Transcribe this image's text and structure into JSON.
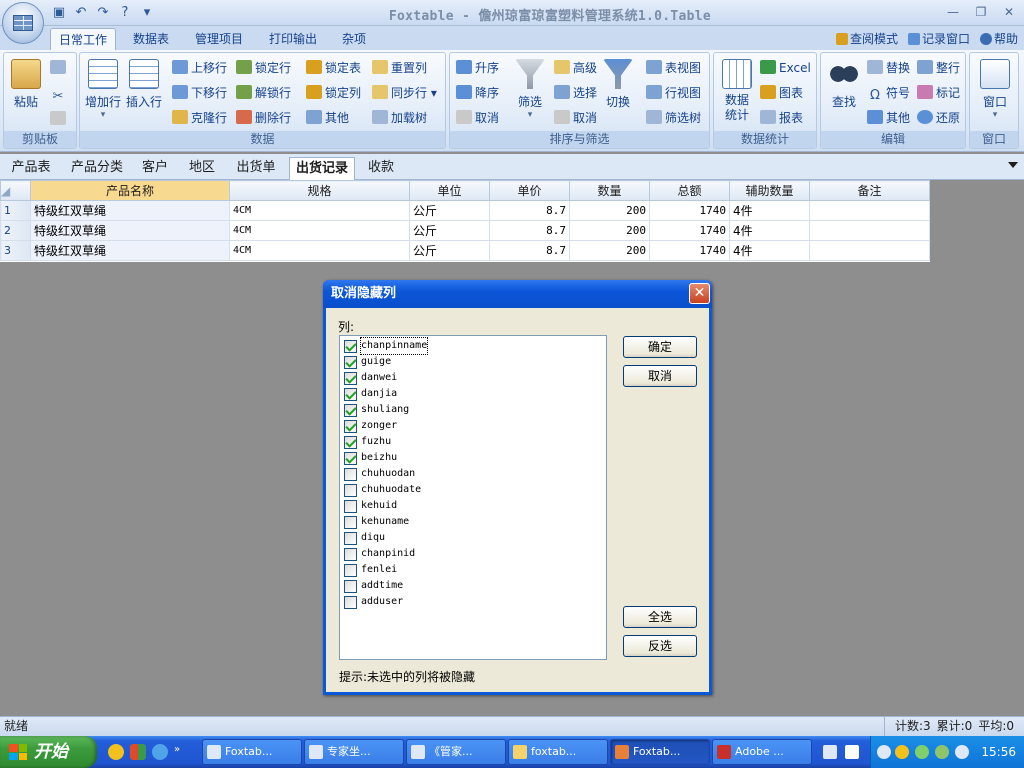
{
  "app": {
    "title": "Foxtable - 儋州琼富琼富塑料管理系统1.0.Table",
    "win_min": "—",
    "win_max": "❐",
    "win_close": "✕"
  },
  "ribbon_tabs": [
    "日常工作",
    "数据表",
    "管理项目",
    "打印输出",
    "杂项"
  ],
  "top_right": {
    "view_mode": "查阅模式",
    "record_window": "记录窗口",
    "help": "帮助"
  },
  "ribbon": {
    "clipboard": {
      "label": "剪贴板",
      "paste": "粘贴"
    },
    "data": {
      "label": "数据",
      "add_row": "增加行",
      "insert_row": "插入行",
      "move_up": "上移行",
      "move_down": "下移行",
      "clone_row": "克隆行",
      "lock_row": "锁定行",
      "unlock_row": "解锁行",
      "delete_row": "删除行",
      "lock_table": "锁定表",
      "lock_col": "锁定列",
      "other": "其他",
      "reset_col": "重置列",
      "sync_row": "同步行",
      "load_tree": "加载树"
    },
    "sort_filter": {
      "label": "排序与筛选",
      "asc": "升序",
      "desc": "降序",
      "cancel": "取消",
      "filter": "筛选",
      "advanced": "高级",
      "select": "选择",
      "cancel2": "取消",
      "toggle": "切换",
      "table_view": "表视图",
      "row_view": "行视图",
      "filter_tree": "筛选树"
    },
    "stats": {
      "label": "数据统计",
      "data_stats": "数据统计",
      "excel": "Excel",
      "chart": "图表",
      "report": "报表"
    },
    "edit": {
      "label": "编辑",
      "find": "查找",
      "replace": "替换",
      "symbol": "符号",
      "other": "其他",
      "tidy_row": "整行",
      "mark": "标记",
      "restore": "还原"
    },
    "window": {
      "label": "窗口",
      "window": "窗口"
    }
  },
  "sheet_tabs": [
    "产品表",
    "产品分类",
    "客户",
    "地区",
    "出货单",
    "出货记录",
    "收款"
  ],
  "active_sheet": "出货记录",
  "grid": {
    "columns": [
      "产品名称",
      "规格",
      "单位",
      "单价",
      "数量",
      "总额",
      "辅助数量",
      "备注"
    ],
    "rows": [
      {
        "n": "1",
        "name": "特级红双草绳",
        "spec": "4CM",
        "unit": "公斤",
        "price": "8.7",
        "qty": "200",
        "total": "1740",
        "aux": "4件",
        "note": ""
      },
      {
        "n": "2",
        "name": "特级红双草绳",
        "spec": "4CM",
        "unit": "公斤",
        "price": "8.7",
        "qty": "200",
        "total": "1740",
        "aux": "4件",
        "note": ""
      },
      {
        "n": "3",
        "name": "特级红双草绳",
        "spec": "4CM",
        "unit": "公斤",
        "price": "8.7",
        "qty": "200",
        "total": "1740",
        "aux": "4件",
        "note": ""
      }
    ]
  },
  "dialog": {
    "title": "取消隐藏列",
    "close": "✕",
    "list_label": "列:",
    "columns": [
      {
        "name": "chanpinname",
        "checked": true
      },
      {
        "name": "guige",
        "checked": true
      },
      {
        "name": "danwei",
        "checked": true
      },
      {
        "name": "danjia",
        "checked": true
      },
      {
        "name": "shuliang",
        "checked": true
      },
      {
        "name": "zonger",
        "checked": true
      },
      {
        "name": "fuzhu",
        "checked": true
      },
      {
        "name": "beizhu",
        "checked": true
      },
      {
        "name": "chuhuodan",
        "checked": false
      },
      {
        "name": "chuhuodate",
        "checked": false
      },
      {
        "name": "kehuid",
        "checked": false
      },
      {
        "name": "kehuname",
        "checked": false
      },
      {
        "name": "diqu",
        "checked": false
      },
      {
        "name": "chanpinid",
        "checked": false
      },
      {
        "name": "fenlei",
        "checked": false
      },
      {
        "name": "addtime",
        "checked": false
      },
      {
        "name": "adduser",
        "checked": false
      }
    ],
    "ok": "确定",
    "cancel": "取消",
    "select_all": "全选",
    "invert": "反选",
    "hint": "提示:未选中的列将被隐藏"
  },
  "status": {
    "left": "就绪",
    "count": "计数:3",
    "sum": "累计:0",
    "avg": "平均:0"
  },
  "taskbar": {
    "start": "开始",
    "tasks": [
      "Foxtab...",
      "专家坐...",
      "《管家...",
      "foxtab...",
      "Foxtab...",
      "Adobe ..."
    ],
    "active_task_index": 4,
    "clock": "15:56"
  }
}
